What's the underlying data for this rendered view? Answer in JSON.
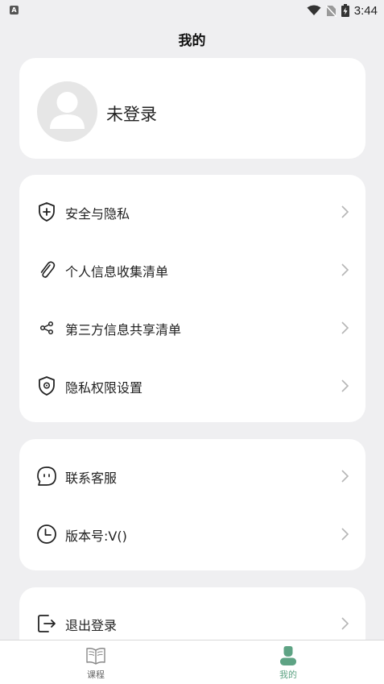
{
  "status_bar": {
    "time": "3:44",
    "app_icon_letter": "A"
  },
  "page": {
    "title": "我的"
  },
  "profile": {
    "name": "未登录"
  },
  "menu_group_1": [
    {
      "label": "安全与隐私",
      "icon": "shield-plus-icon"
    },
    {
      "label": "个人信息收集清单",
      "icon": "paperclip-icon"
    },
    {
      "label": "第三方信息共享清单",
      "icon": "share-icon"
    },
    {
      "label": "隐私权限设置",
      "icon": "shield-gear-icon"
    }
  ],
  "menu_group_2": [
    {
      "label": "联系客服",
      "icon": "chat-bubble-icon"
    },
    {
      "label": "版本号:V()",
      "icon": "clock-icon"
    }
  ],
  "menu_group_3": [
    {
      "label": "退出登录",
      "icon": "logout-icon"
    }
  ],
  "tab_bar": {
    "tabs": [
      {
        "label": "课程",
        "icon": "book-icon",
        "active": false
      },
      {
        "label": "我的",
        "icon": "person-icon",
        "active": true
      }
    ]
  },
  "colors": {
    "accent": "#5ea384",
    "background": "#efeff1",
    "card": "#ffffff",
    "inactive": "#666666"
  }
}
